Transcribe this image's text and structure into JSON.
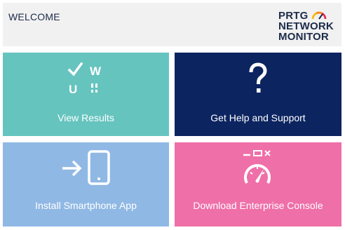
{
  "header": {
    "welcome": "WELCOME",
    "logo": {
      "line1": "PRTG",
      "line2": "NETWORK",
      "line3": "MONITOR"
    }
  },
  "tiles": [
    {
      "label": "View Results",
      "icon": "vwu-results-icon",
      "color": "#66c4bf"
    },
    {
      "label": "Get Help and Support",
      "icon": "question-mark-icon",
      "color": "#0c2460"
    },
    {
      "label": "Install Smartphone App",
      "icon": "smartphone-arrow-icon",
      "color": "#90b8e4"
    },
    {
      "label": "Download Enterprise Console",
      "icon": "console-gauge-icon",
      "color": "#ef6fa8"
    }
  ],
  "colors": {
    "header_bg": "#f1f1f1",
    "brand_text": "#1c2b4a"
  }
}
